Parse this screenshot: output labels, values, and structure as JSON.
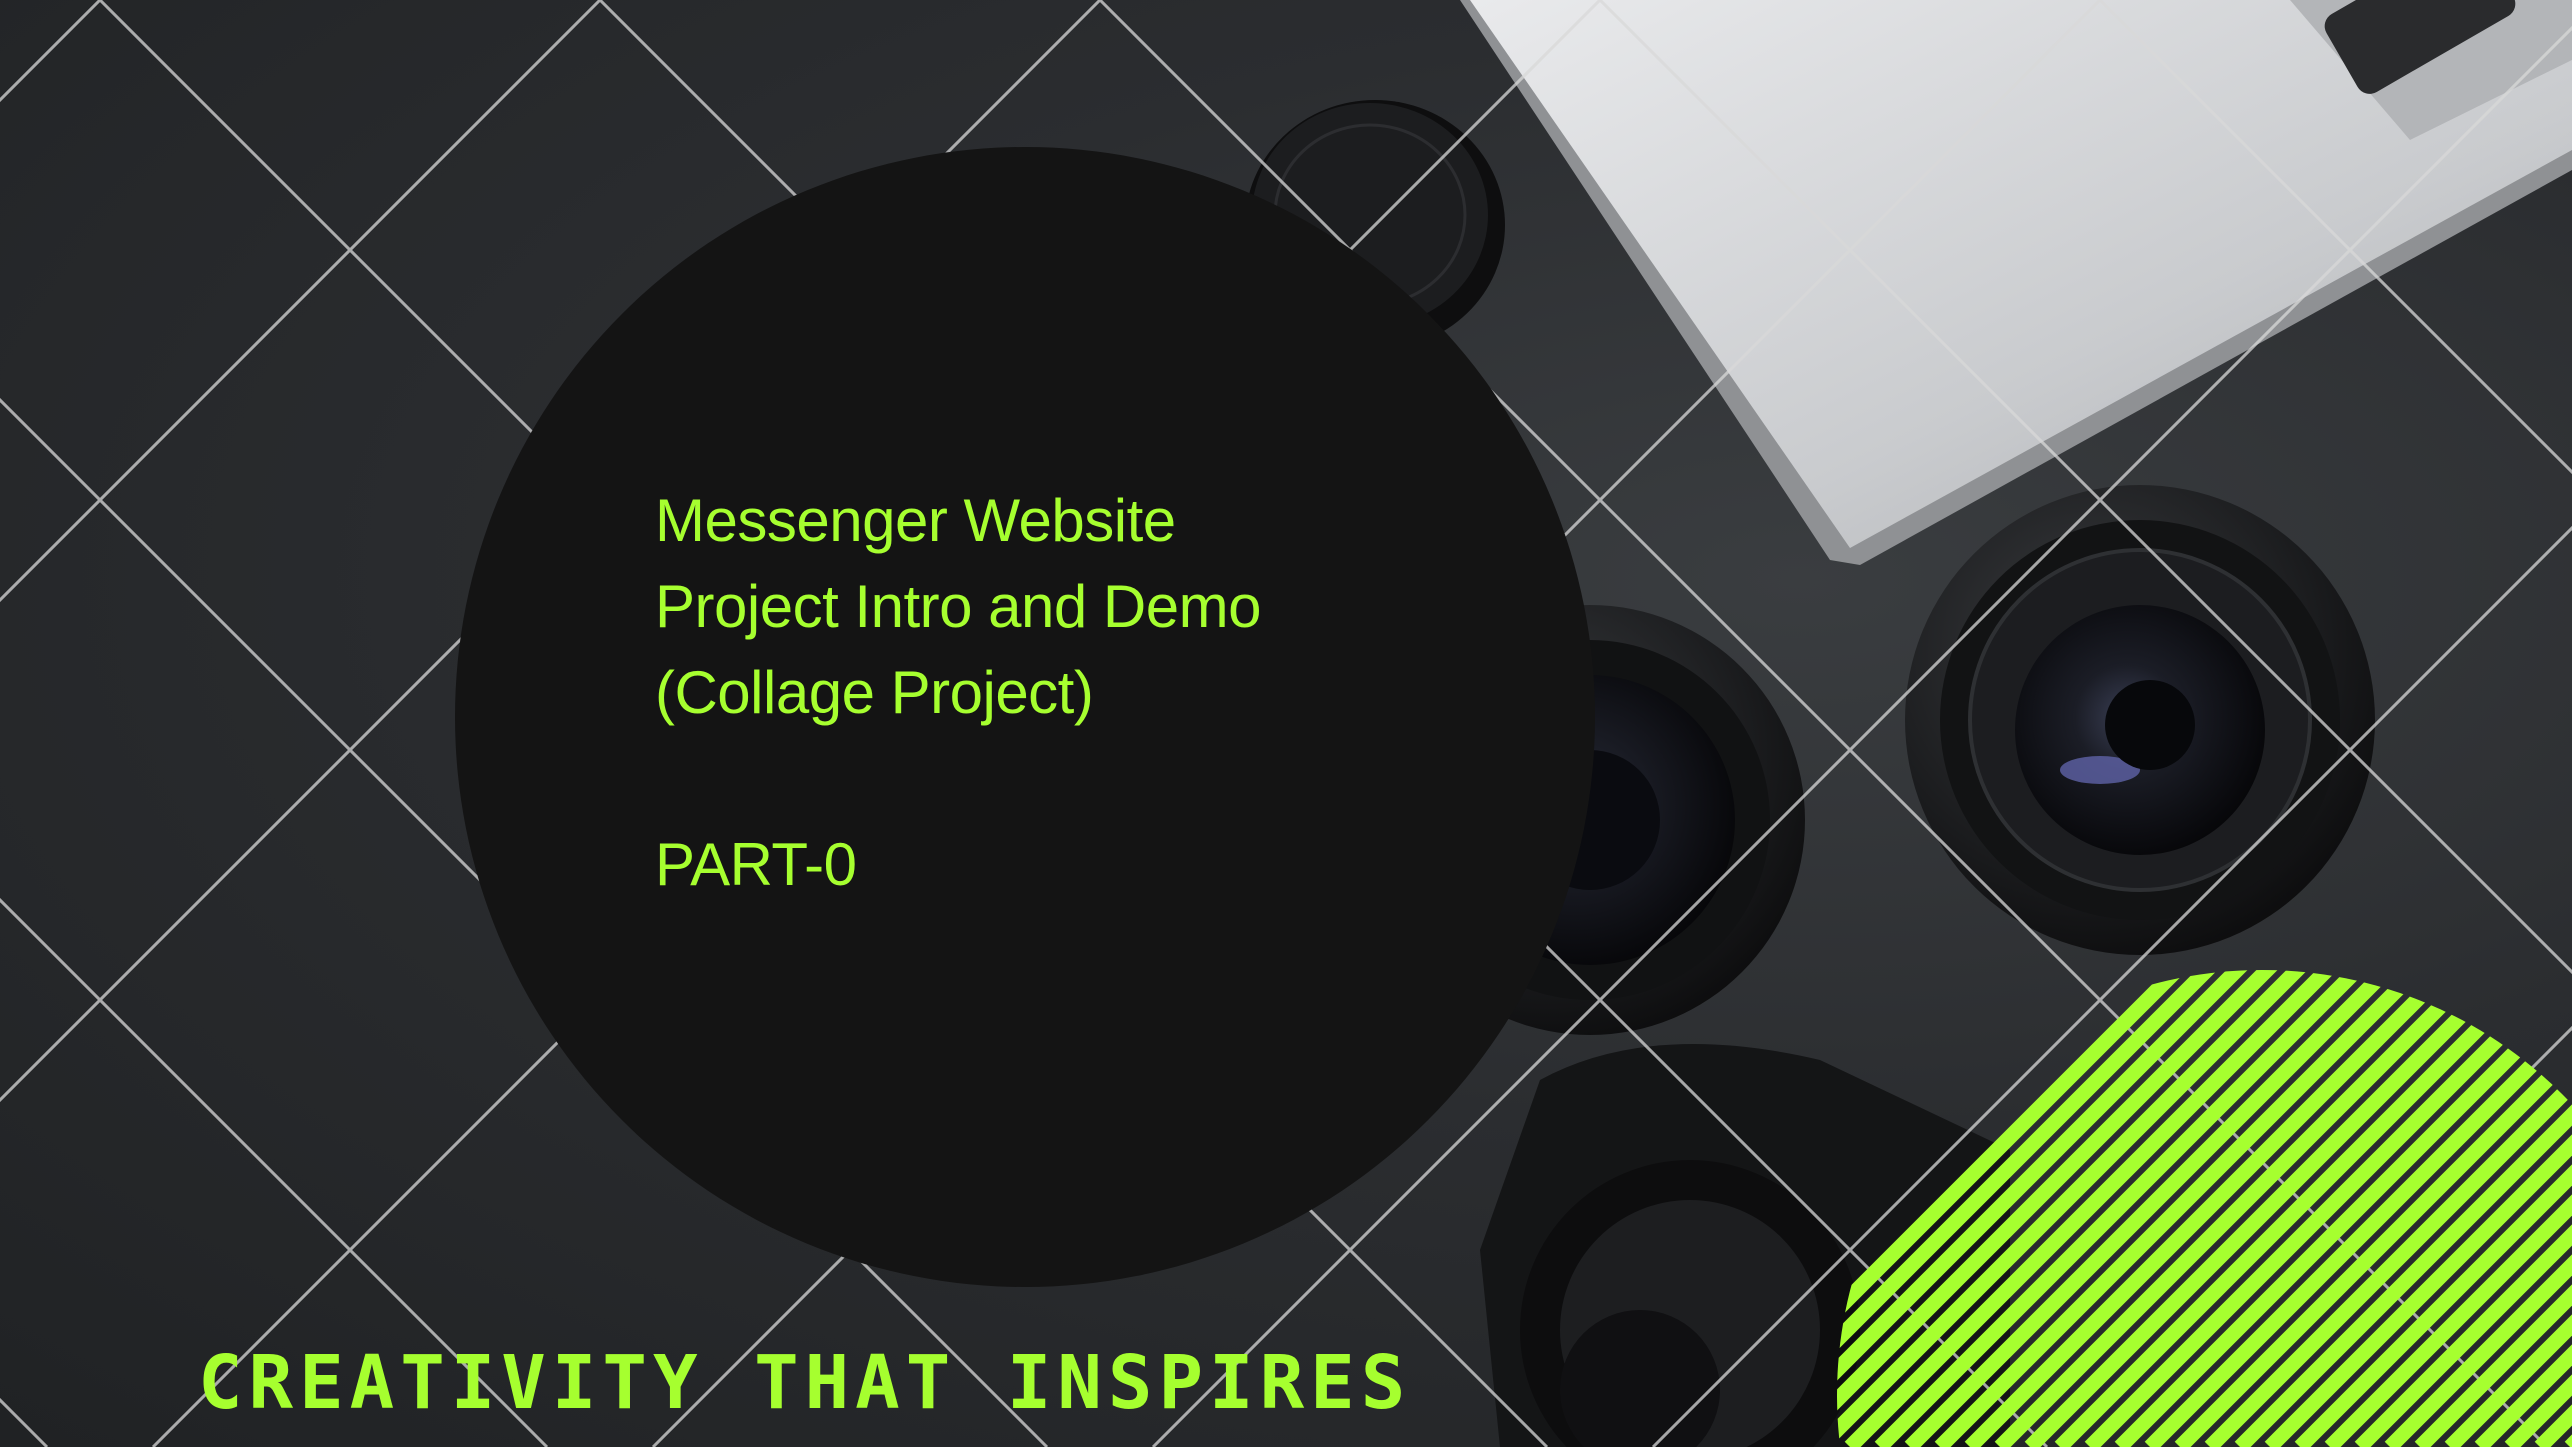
{
  "slide": {
    "title_lines": [
      "Messenger Website",
      "Project Intro and Demo",
      "(Collage Project)"
    ],
    "part_label": "PART-0",
    "tagline": "CREATIVITY THAT INSPIRES"
  },
  "colors": {
    "accent": "#a6ff2f",
    "circle": "#141414",
    "background": "#2b2d30",
    "grid_lines": "#d9d9d9"
  },
  "icons": {
    "background": "camera-lens-photo",
    "decoration": "striped-circle"
  }
}
